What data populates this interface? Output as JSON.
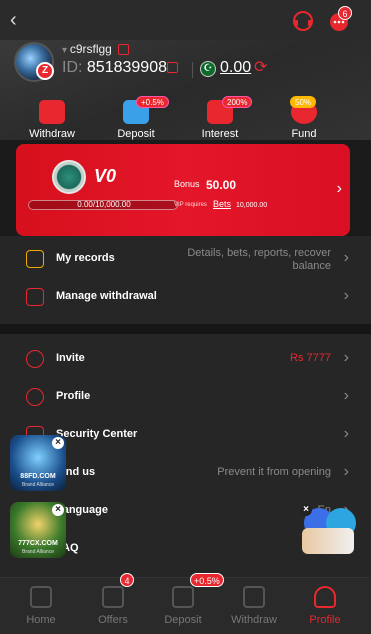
{
  "topbar": {
    "back_icon": "chevron-left-icon",
    "notification_badge": "6"
  },
  "user": {
    "username": "c9rsflgg",
    "id_label": "ID:",
    "id": "851839908",
    "balance": "0.00"
  },
  "quick_actions": [
    {
      "label": "Withdraw",
      "tag": ""
    },
    {
      "label": "Deposit",
      "tag": "+0.5%"
    },
    {
      "label": "Interest",
      "tag": "200%"
    },
    {
      "label": "Fund",
      "tag": "50%"
    }
  ],
  "vip": {
    "level": "V0",
    "progress": "0.00/10,000.00",
    "bonus_label": "Bonus",
    "bonus_value": "50.00",
    "requires_label": "VIP requires",
    "bets_label": "Bets",
    "requires_value": "10,000.00"
  },
  "records": [
    {
      "label": "My records",
      "value_line1": "Details, bets, reports, recover",
      "value_line2": "balance"
    },
    {
      "label": "Manage withdrawal",
      "value_line1": "",
      "value_line2": ""
    }
  ],
  "settings": [
    {
      "label": "Invite",
      "value": "Rs 7777"
    },
    {
      "label": "Profile",
      "value": ""
    },
    {
      "label": "Security Center",
      "value": ""
    },
    {
      "label": "Find us",
      "value": "Prevent it from opening"
    },
    {
      "label": "Language",
      "value": "En"
    },
    {
      "label": "FAQ",
      "value": ""
    }
  ],
  "floating_ads": [
    {
      "brand": "88FD.COM",
      "sub": "Brand Alliance"
    },
    {
      "brand": "777CX.COM",
      "sub": "Brand Alliance"
    }
  ],
  "tabs": [
    {
      "label": "Home",
      "badge": ""
    },
    {
      "label": "Offers",
      "badge": "4"
    },
    {
      "label": "Deposit",
      "badge": "+0.5%"
    },
    {
      "label": "Withdraw",
      "badge": ""
    },
    {
      "label": "Profile",
      "badge": ""
    }
  ],
  "colors": {
    "accent": "#e8272f",
    "background": "#1b1b1b",
    "card": "#262626"
  }
}
